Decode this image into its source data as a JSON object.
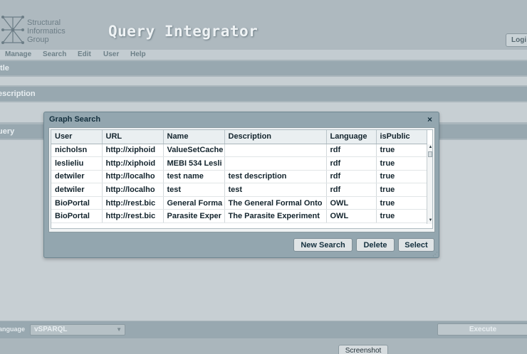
{
  "header": {
    "logo_lines": [
      "Structural",
      "Informatics",
      "Group"
    ],
    "app_title": "Query Integrator",
    "login_label": "Logi"
  },
  "menu": [
    "Manage",
    "Search",
    "Edit",
    "User",
    "Help"
  ],
  "form": {
    "title_label": "itle",
    "description_label": "escription",
    "query_label": "uery"
  },
  "bottom": {
    "language_label": "anguage",
    "language_value": "vSPARQL",
    "execute_label": "Execute",
    "screenshot_label": "Screenshot"
  },
  "dialog": {
    "title": "Graph Search",
    "close_glyph": "×",
    "columns": [
      "User",
      "URL",
      "Name",
      "Description",
      "Language",
      "isPublic"
    ],
    "rows": [
      [
        "nicholsn",
        "http://xiphoid",
        "ValueSetCache",
        "",
        "rdf",
        "true"
      ],
      [
        "leslieliu",
        "http://xiphoid",
        "MEBI 534 Lesli",
        "",
        "rdf",
        "true"
      ],
      [
        "detwiler",
        "http://localho",
        "test name",
        "test description",
        "rdf",
        "true"
      ],
      [
        "detwiler",
        "http://localho",
        "test",
        "test",
        "rdf",
        "true"
      ],
      [
        "BioPortal",
        "http://rest.bic",
        "General Forma",
        "The General Formal Onto",
        "OWL",
        "true"
      ],
      [
        "BioPortal",
        "http://rest.bic",
        "Parasite Exper",
        "The Parasite Experiment",
        "OWL",
        "true"
      ]
    ],
    "buttons": {
      "new_search": "New Search",
      "delete": "Delete",
      "select": "Select"
    }
  },
  "colors": {
    "page_bg": "#aab6bc",
    "dialog_bg": "#93a6af",
    "title_text": "#14303e"
  }
}
